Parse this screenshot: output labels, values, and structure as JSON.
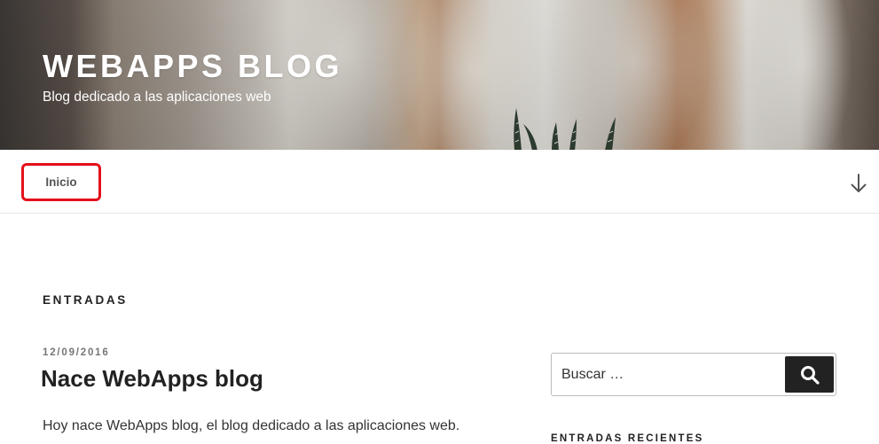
{
  "header": {
    "title": "WEBAPPS BLOG",
    "description": "Blog dedicado a las aplicaciones web"
  },
  "nav": {
    "items": [
      {
        "label": "Inicio"
      }
    ],
    "scroll_icon": "arrow-down-icon"
  },
  "main": {
    "section_title": "ENTRADAS",
    "posts": [
      {
        "date": "12/09/2016",
        "title": "Nace WebApps blog",
        "excerpt": "Hoy nace WebApps blog, el blog dedicado a las aplicaciones web."
      }
    ]
  },
  "sidebar": {
    "search": {
      "placeholder": "Buscar …",
      "button_icon": "search-icon"
    },
    "recent_title": "ENTRADAS RECIENTES"
  },
  "colors": {
    "highlight": "#e3111b",
    "search_button": "#222222"
  }
}
